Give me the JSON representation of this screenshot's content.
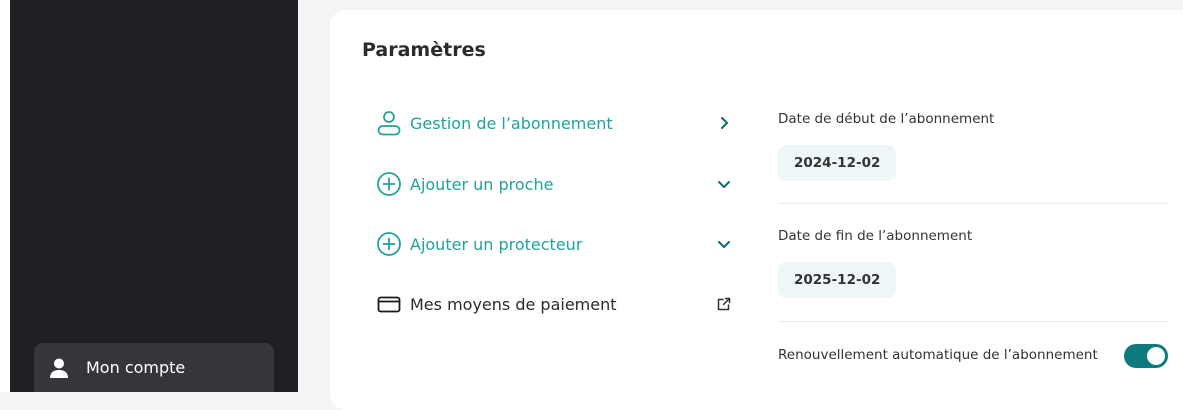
{
  "sidebar": {
    "account_label": "Mon compte"
  },
  "settings": {
    "title": "Paramètres",
    "menu": [
      {
        "label": "Gestion de l’abonnement",
        "icon": "user-icon",
        "right_icon": "chevron-right-icon"
      },
      {
        "label": "Ajouter un proche",
        "icon": "plus-circle-icon",
        "right_icon": "chevron-down-icon"
      },
      {
        "label": "Ajouter un protecteur",
        "icon": "plus-circle-icon",
        "right_icon": "chevron-down-icon"
      },
      {
        "label": "Mes moyens de paiement",
        "icon": "credit-card-icon",
        "right_icon": "external-link-icon"
      }
    ],
    "subscription": {
      "start_label": "Date de début de l’abonnement",
      "start_value": "2024-12-02",
      "end_label": "Date de fin de l’abonnement",
      "end_value": "2025-12-02",
      "auto_renew_label": "Renouvellement automatique de l’abonnement",
      "auto_renew_enabled": true
    }
  },
  "colors": {
    "accent": "#1fa39a",
    "toggle_on": "#0e7a7e",
    "sidebar_bg": "#1f2024"
  }
}
